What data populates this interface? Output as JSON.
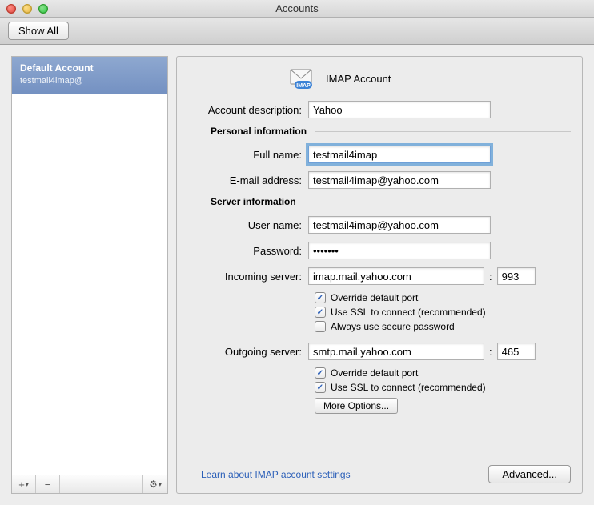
{
  "window": {
    "title": "Accounts"
  },
  "toolbar": {
    "show_all": "Show All"
  },
  "sidebar": {
    "header_title": "Default Account",
    "header_blurred": " ",
    "header_email_prefix": "testmail4imap@",
    "header_email_obscured": "     ",
    "add_label": "+",
    "remove_label": "−",
    "gear_label": "⚙"
  },
  "main": {
    "account_type_label": "IMAP Account",
    "labels": {
      "description": "Account description:",
      "personal": "Personal information",
      "full_name": "Full name:",
      "email": "E-mail address:",
      "server_info": "Server information",
      "user_name": "User name:",
      "password": "Password:",
      "incoming": "Incoming server:",
      "outgoing": "Outgoing server:"
    },
    "values": {
      "description": "Yahoo",
      "full_name": "testmail4imap",
      "email": "testmail4imap@yahoo.com",
      "user_name": "testmail4imap@yahoo.com",
      "password": "•••••••",
      "incoming_server": "imap.mail.yahoo.com",
      "incoming_port": "993",
      "outgoing_server": "smtp.mail.yahoo.com",
      "outgoing_port": "465"
    },
    "checkboxes": {
      "in_override": "Override default port",
      "in_ssl": "Use SSL to connect (recommended)",
      "in_secure": "Always use secure password",
      "out_override": "Override default port",
      "out_ssl": "Use SSL to connect (recommended)"
    },
    "more_options": "More Options...",
    "learn_link": "Learn about IMAP account settings",
    "advanced": "Advanced..."
  }
}
